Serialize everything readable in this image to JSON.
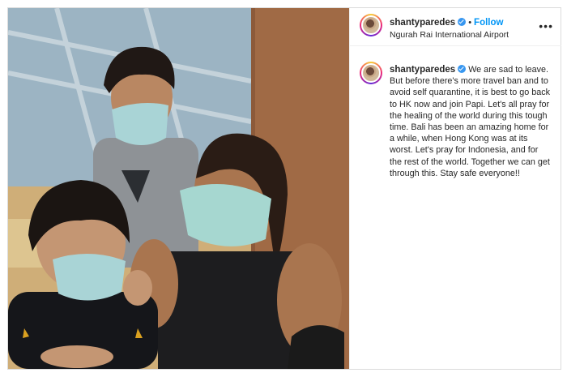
{
  "post": {
    "username": "shantyparedes",
    "follow_label": "Follow",
    "separator": "•",
    "location": "Ngurah Rai International Airport",
    "more_label": "•••",
    "caption": "We are sad to leave. But before there's more travel ban and to avoid self quarantine, it is best to go back to HK now and join Papi. Let's all pray for the healing of the world during this tough time. Bali has been an amazing home for a while, when Hong Kong was at its worst. Let's pray for Indonesia, and for the rest of the world. Together we can get through this. Stay safe everyone!!",
    "photo_subject": "mother and two sons wearing face masks at airport"
  },
  "colors": {
    "follow": "#0095f6",
    "verified": "#3897f0",
    "border": "#dbdbdb",
    "text": "#262626"
  }
}
